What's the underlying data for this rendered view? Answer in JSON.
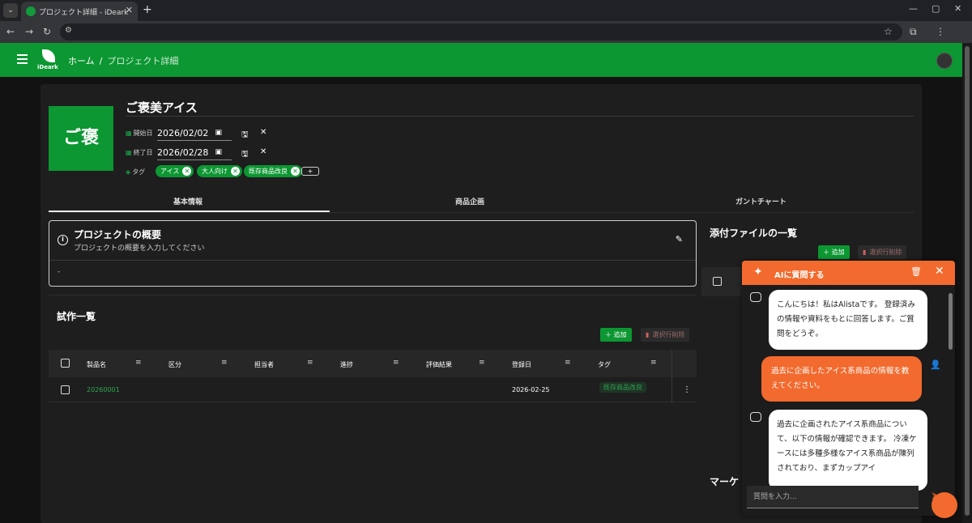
{
  "browser": {
    "tab_title": "プロジェクト詳細 - iDeark",
    "tab_close": "✕",
    "new_tab": "+",
    "menu": "⌄",
    "back": "←",
    "forward": "→",
    "reload": "↻",
    "site_info": "⚙",
    "star": "☆",
    "extensions": "⧉",
    "more": "⋮",
    "minimize": "—",
    "maximize": "▢",
    "close": "✕"
  },
  "header": {
    "logo_text": "iDeark",
    "breadcrumb_home": "ホーム",
    "breadcrumb_sep": "/",
    "breadcrumb_current": "プロジェクト詳細"
  },
  "project": {
    "thumb_text": "ご褒",
    "title": "ご褒美アイス",
    "start_label": "開始日",
    "start_value": "2026/02/02",
    "end_label": "終了日",
    "end_value": "2026/02/28",
    "tag_label": "タグ",
    "tags": [
      "アイス",
      "大人向け",
      "既存商品改良"
    ],
    "tag_add": "+",
    "save_icon": "🖫",
    "cancel_icon": "✕"
  },
  "tabs": [
    "基本情報",
    "商品企画",
    "ガントチャート"
  ],
  "overview": {
    "title": "プロジェクトの概要",
    "subtitle": "プロジェクトの概要を入力してください",
    "body": "-",
    "info_icon": "i",
    "edit_icon": "✎"
  },
  "prototypes": {
    "title": "試作一覧",
    "add_label": "＋ 追加",
    "delete_label": "選択行削除",
    "columns": [
      "製品名",
      "区分",
      "担当者",
      "進捗",
      "評価結果",
      "登録日",
      "タグ"
    ],
    "filter_icon": "≡",
    "rows": [
      {
        "name": "20260001",
        "category": "",
        "owner": "",
        "progress": "",
        "result": "",
        "date": "2026-02-25",
        "tag": "既存商品改良"
      }
    ],
    "row_menu": "⋮"
  },
  "attachments": {
    "title": "添付ファイルの一覧",
    "add_label": "＋ 追加",
    "delete_label": "選択行削除"
  },
  "marketing": {
    "title": "マーケ"
  },
  "chat": {
    "title": "AIに質問する",
    "spark_icon": "✦",
    "trash_icon": "🗑",
    "close_icon": "✕",
    "messages": [
      {
        "role": "bot",
        "text": "こんにちは！私はAlistaです。 登録済みの情報や資料をもとに回答します。ご質問をどうぞ。"
      },
      {
        "role": "user",
        "text": "過去に企画したアイス系商品の情報を教えてください。"
      },
      {
        "role": "bot",
        "text": "過去に企画されたアイス系商品について、以下の情報が確認できます。 冷凍ケースには多種多様なアイス系商品が陳列されており、まずカップアイ"
      }
    ],
    "user_icon": "👤",
    "input_placeholder": "質問を入力...",
    "send_icon": "➤"
  },
  "colors": {
    "brand_green": "#0c9732",
    "accent_orange": "#f26a2e"
  }
}
